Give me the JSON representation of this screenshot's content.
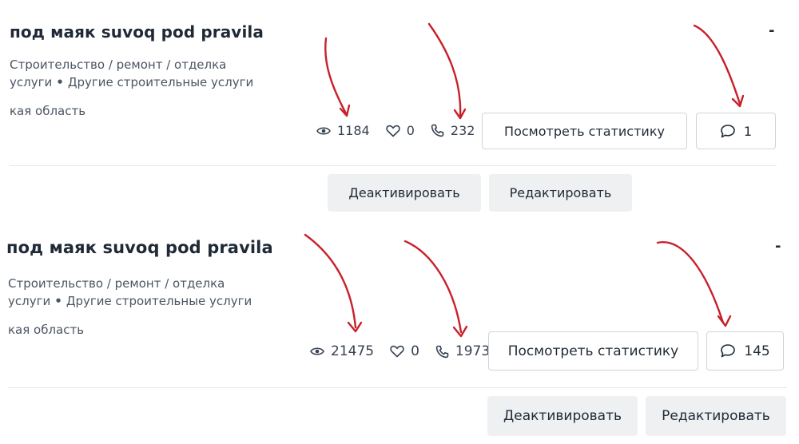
{
  "listings": [
    {
      "title": "под маяк suvoq pod pravila",
      "more_label": "-",
      "category_line": "Строительство / ремонт / отделка",
      "subcategory_prefix": "услуги",
      "subcategory": "Другие строительные услуги",
      "region": "кая область",
      "views": "1184",
      "likes": "0",
      "calls": "232",
      "stats_button": "Посмотреть статистику",
      "messages": "1",
      "deactivate": "Деактивировать",
      "edit": "Редактировать"
    },
    {
      "title": "под маяк suvoq pod pravila",
      "more_label": "-",
      "category_line": "Строительство / ремонт / отделка",
      "subcategory_prefix": "услуги",
      "subcategory": "Другие строительные услуги",
      "region": "кая область",
      "views": "21475",
      "likes": "0",
      "calls": "1973",
      "stats_button": "Посмотреть статистику",
      "messages": "145",
      "deactivate": "Деактивировать",
      "edit": "Редактировать"
    }
  ],
  "icons": {
    "views": "eye-icon",
    "likes": "heart-icon",
    "calls": "phone-icon",
    "messages": "chat-bubble-icon",
    "annotation": "red-arrow-icon"
  },
  "colors": {
    "annotation_arrow": "#c8202a",
    "button_border": "#cfd4da",
    "button_fill": "#eef0f2",
    "text_dark": "#1f2a36"
  }
}
